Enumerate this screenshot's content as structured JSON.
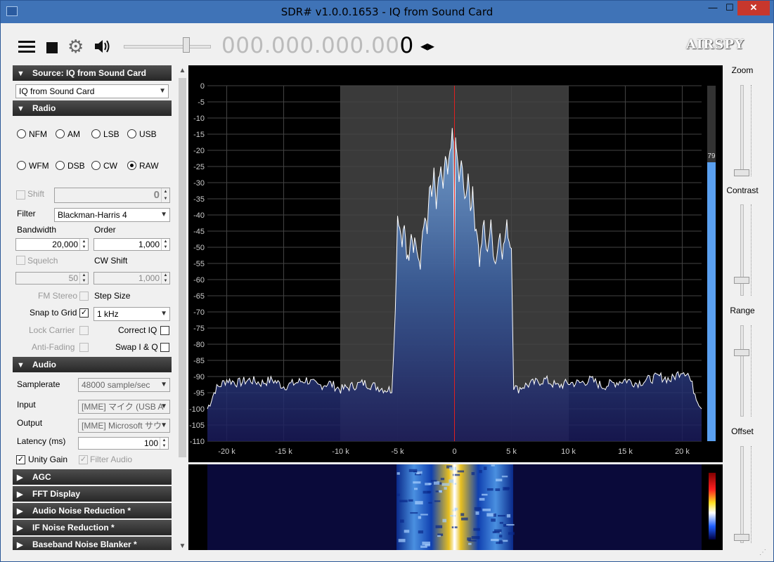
{
  "window": {
    "title": "SDR# v1.0.0.1653 - IQ from Sound Card",
    "minimize": "—",
    "maximize": "☐",
    "close": "✕"
  },
  "toolbar": {
    "frequency_dim": "000.000.000.00",
    "frequency_last": "0",
    "tune_arrows": "◂▸",
    "logo": "AIRSPY"
  },
  "source": {
    "header": "Source: IQ from Sound Card",
    "selected": "IQ from Sound Card"
  },
  "radio": {
    "header": "Radio",
    "modes": [
      {
        "label": "NFM",
        "checked": false
      },
      {
        "label": "AM",
        "checked": false
      },
      {
        "label": "LSB",
        "checked": false
      },
      {
        "label": "USB",
        "checked": false
      },
      {
        "label": "WFM",
        "checked": false
      },
      {
        "label": "DSB",
        "checked": false
      },
      {
        "label": "CW",
        "checked": false
      },
      {
        "label": "RAW",
        "checked": true
      }
    ],
    "shift_label": "Shift",
    "shift_value": "0",
    "filter_label": "Filter",
    "filter_value": "Blackman-Harris 4",
    "bandwidth_label": "Bandwidth",
    "bandwidth_value": "20,000",
    "order_label": "Order",
    "order_value": "1,000",
    "squelch_label": "Squelch",
    "squelch_value": "50",
    "cwshift_label": "CW Shift",
    "cwshift_value": "1,000",
    "fmstereo_label": "FM Stereo",
    "stepsize_label": "Step Size",
    "snap_label": "Snap to Grid",
    "snap_checked": "✓",
    "step_value": "1 kHz",
    "lockcarrier_label": "Lock Carrier",
    "correctiq_label": "Correct IQ",
    "antifading_label": "Anti-Fading",
    "swapiq_label": "Swap I & Q"
  },
  "audio": {
    "header": "Audio",
    "samplerate_label": "Samplerate",
    "samplerate_value": "48000 sample/sec",
    "input_label": "Input",
    "input_value": "[MME] マイク (USB A",
    "output_label": "Output",
    "output_value": "[MME] Microsoft サウ",
    "latency_label": "Latency (ms)",
    "latency_value": "100",
    "unity_label": "Unity Gain",
    "unity_checked": "✓",
    "filter_audio_label": "Filter Audio",
    "filter_audio_checked": "✓"
  },
  "collapsed_sections": [
    "AGC",
    "FFT Display",
    "Audio Noise Reduction *",
    "IF Noise Reduction *",
    "Baseband Noise Blanker *"
  ],
  "right_panel": {
    "zoom": "Zoom",
    "contrast": "Contrast",
    "range": "Range",
    "offset": "Offset"
  },
  "chart_data": {
    "type": "area",
    "title": "",
    "xlabel": "",
    "ylabel": "",
    "x_ticks": [
      "-20 k",
      "-15 k",
      "-10 k",
      "-5 k",
      "0",
      "5 k",
      "10 k",
      "15 k",
      "20 k"
    ],
    "y_ticks": [
      "0",
      "-5",
      "-10",
      "-15",
      "-20",
      "-25",
      "-30",
      "-35",
      "-40",
      "-45",
      "-50",
      "-55",
      "-60",
      "-65",
      "-70",
      "-75",
      "-80",
      "-85",
      "-90",
      "-95",
      "-100",
      "-105",
      "-110"
    ],
    "xlim_khz": [
      -21.7,
      21.7
    ],
    "ylim_db": [
      -110,
      0
    ],
    "passband_khz": [
      -10,
      10
    ],
    "center_marker_khz": 0,
    "level_meter_value": "79",
    "series": [
      {
        "x_khz": [
          -21.7,
          -21,
          -20,
          -19,
          -18,
          -17,
          -16,
          -15,
          -14,
          -13,
          -12,
          -11,
          -10,
          -9,
          -8,
          -7,
          -6,
          -5.5,
          -5.2,
          -5,
          -4.8,
          -4.6,
          -4.4,
          -4.2,
          -4,
          -3.8,
          -3.6,
          -3.4,
          -3.2,
          -3,
          -2.8,
          -2.6,
          -2.4,
          -2.2,
          -2,
          -1.8,
          -1.6,
          -1.4,
          -1.2,
          -1,
          -0.8,
          -0.6,
          -0.4,
          -0.2,
          -0.1,
          0,
          0.1,
          0.2,
          0.4,
          0.6,
          0.8,
          1,
          1.2,
          1.4,
          1.6,
          1.8,
          2,
          2.2,
          2.4,
          2.6,
          2.8,
          3,
          3.2,
          3.4,
          3.6,
          3.8,
          4,
          4.2,
          4.4,
          4.6,
          4.8,
          5,
          5.2,
          5.5,
          6,
          7,
          8,
          9,
          10,
          11,
          12,
          13,
          14,
          15,
          16,
          17,
          18,
          19,
          20,
          20.5,
          21,
          21.7
        ],
        "y_db": [
          -100,
          -94,
          -91,
          -92,
          -91,
          -92,
          -91,
          -93,
          -92,
          -91,
          -93,
          -92,
          -94,
          -93,
          -92,
          -93,
          -94,
          -94,
          -70,
          -40,
          -44,
          -48,
          -43,
          -53,
          -55,
          -45,
          -50,
          -47,
          -52,
          -55,
          -45,
          -41,
          -46,
          -30,
          -35,
          -27,
          -38,
          -30,
          -25,
          -33,
          -22,
          -28,
          -20,
          -15,
          -18,
          -60,
          -16,
          -22,
          -28,
          -23,
          -32,
          -35,
          -26,
          -38,
          -33,
          -43,
          -45,
          -55,
          -48,
          -42,
          -52,
          -48,
          -43,
          -51,
          -55,
          -50,
          -45,
          -52,
          -48,
          -43,
          -48,
          -50,
          -93,
          -94,
          -93,
          -92,
          -91,
          -93,
          -92,
          -92,
          -91,
          -93,
          -92,
          -91,
          -92,
          -91,
          -90,
          -91,
          -88,
          -89,
          -94,
          -100
        ]
      }
    ]
  }
}
